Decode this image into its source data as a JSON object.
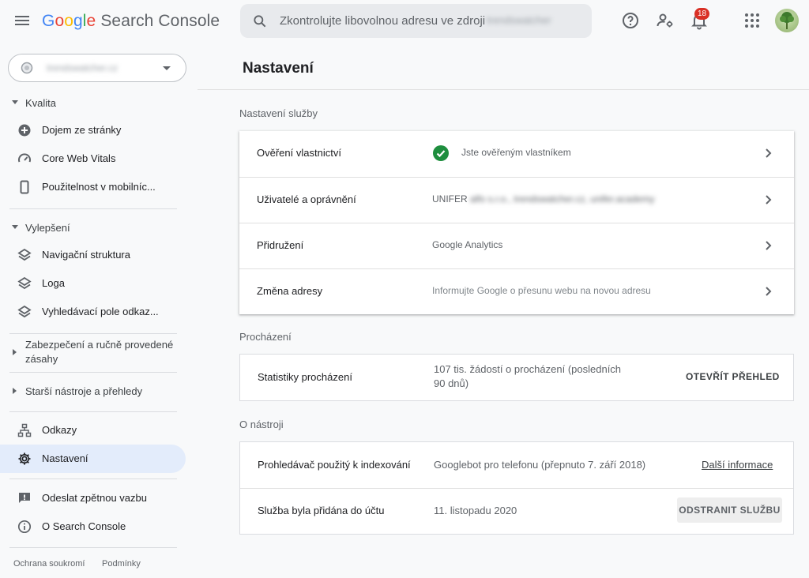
{
  "header": {
    "logo": {
      "g": "G",
      "o1": "o",
      "o2": "o",
      "g2": "g",
      "l": "l",
      "e": "e",
      "product": "Search Console"
    },
    "search_placeholder": "Zkontrolujte libovolnou adresu ve zdroji",
    "search_property_blurred": "trendswatcher",
    "notification_count": "18"
  },
  "sidebar": {
    "property": "trendswatcher.cz",
    "sections": {
      "kvalita": "Kvalita",
      "vylepseni": "Vylepšení",
      "zabezpeceni_1": "Zabezpečení a ručně provedené",
      "zabezpeceni_2": "zásahy",
      "starsi": "Starší nástroje a přehledy"
    },
    "items": {
      "dojem": "Dojem ze stránky",
      "cwv": "Core Web Vitals",
      "mobile": "Použitelnost v mobilníc...",
      "navig": "Navigační struktura",
      "loga": "Loga",
      "vyhled": "Vyhledávací pole odkaz...",
      "odkazy": "Odkazy",
      "nastaveni": "Nastavení",
      "feedback": "Odeslat zpětnou vazbu",
      "about": "O Search Console"
    },
    "footer": {
      "privacy": "Ochrana soukromí",
      "terms": "Podmínky"
    }
  },
  "main": {
    "title": "Nastavení",
    "service_settings": {
      "label": "Nastavení služby",
      "rows": [
        {
          "label": "Ověření vlastnictví",
          "value": "Jste ověřeným vlastníkem"
        },
        {
          "label": "Uživatelé a oprávnění",
          "value": "UNIFER",
          "value_blurred": "alfo s.r.o., trendswatcher.cz, unifer.academy"
        },
        {
          "label": "Přidružení",
          "value": "Google Analytics"
        },
        {
          "label": "Změna adresy",
          "value": "Informujte Google o přesunu webu na novou adresu"
        }
      ]
    },
    "crawl": {
      "label": "Procházení",
      "row_label": "Statistiky procházení",
      "value_line1": "107 tis. žádostí o procházení (posledních",
      "value_line2": "90 dnů)",
      "button": "OTEVŘÍT PŘEHLED"
    },
    "about_tool": {
      "label": "O nástroji",
      "crawler_label": "Prohledávač použitý k indexování",
      "crawler_value": "Googlebot pro telefonu (přepnuto 7. září 2018)",
      "crawler_link": "Další informace",
      "added_label": "Služba byla přidána do účtu",
      "added_value": "11. listopadu 2020",
      "remove_button": "ODSTRANIT SLUŽBU"
    }
  },
  "colors": {
    "accent_active": "#e3ecfb",
    "verified_green": "#1e8e3e",
    "badge_red": "#d93025"
  }
}
